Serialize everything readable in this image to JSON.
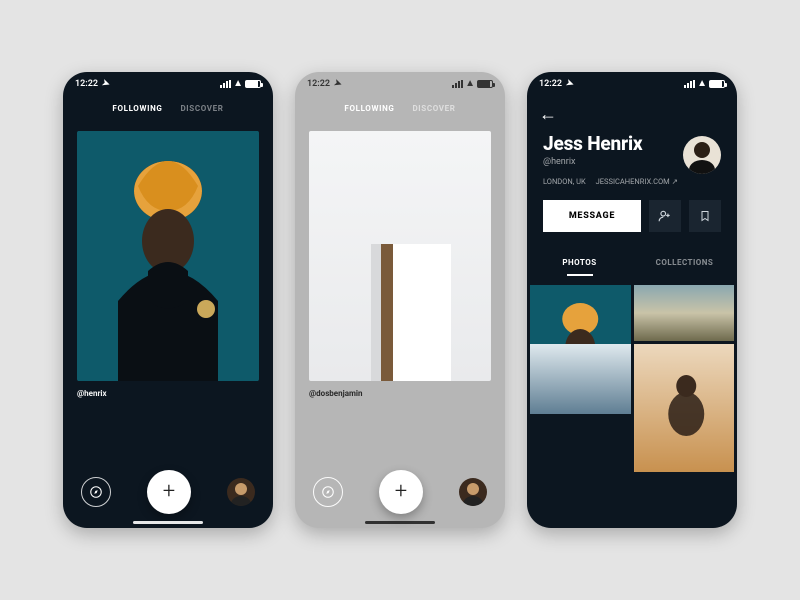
{
  "status": {
    "time": "12:22"
  },
  "feed": {
    "tabs": {
      "following": "FOLLOWING",
      "discover": "DISCOVER"
    },
    "screen1": {
      "author": "@henrix"
    },
    "screen2": {
      "author": "@dosbenjamin"
    }
  },
  "nav": {
    "plus": "+"
  },
  "profile": {
    "name": "Jess Henrix",
    "handle": "@henrix",
    "location": "LONDON, UK",
    "website": "JESSICAHENRIX.COM",
    "actions": {
      "message": "MESSAGE"
    },
    "tabs": {
      "photos": "PHOTOS",
      "collections": "COLLECTIONS"
    }
  }
}
